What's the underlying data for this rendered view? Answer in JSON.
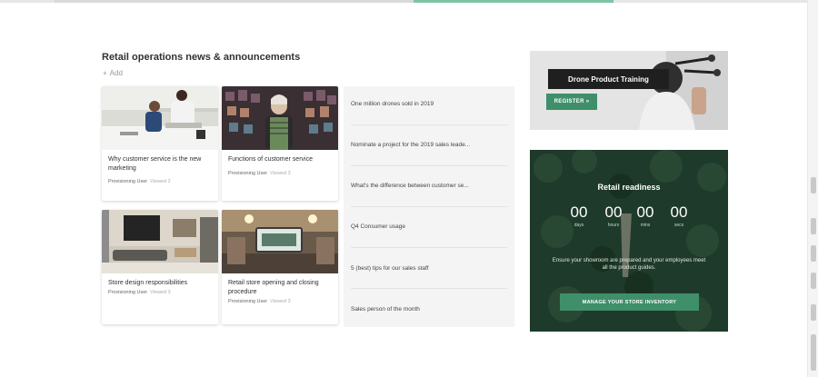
{
  "news": {
    "title": "Retail operations news & announcements",
    "add_label": "Add",
    "cards": [
      {
        "title": "Why customer service is the new marketing",
        "author": "Provisioning User",
        "views": "Viewed 2"
      },
      {
        "title": "Functions of customer service",
        "author": "Provisioning User",
        "views": "Viewed 3"
      },
      {
        "title": "Store design responsibilities",
        "author": "Provisioning User",
        "views": "Viewed 3"
      },
      {
        "title": "Retail store opening and closing procedure",
        "author": "Provisioning User",
        "views": "Viewed 3"
      }
    ],
    "headlines": [
      "One million drones sold in 2019",
      "Nominate a project for the 2019 sales leade...",
      "What's the difference between customer se...",
      "Q4 Consumer usage",
      "5 (best) tips for our sales staff",
      "Sales person of the month"
    ]
  },
  "promo": {
    "label": "Drone Product Training",
    "button_label": "REGISTER »"
  },
  "countdown": {
    "title": "Retail readiness",
    "units": [
      {
        "value": "00",
        "label": "days"
      },
      {
        "value": "00",
        "label": "hours"
      },
      {
        "value": "00",
        "label": "mins"
      },
      {
        "value": "00",
        "label": "secs"
      }
    ],
    "description": "Ensure your showroom are prepared and your employees meet all the product guides.",
    "button_label": "MANAGE YOUR STORE INVENTORY"
  },
  "colors": {
    "accent": "#3f8f6b",
    "countdown_bg": "#1f3b2a",
    "dark_label": "#1f1f1f"
  }
}
